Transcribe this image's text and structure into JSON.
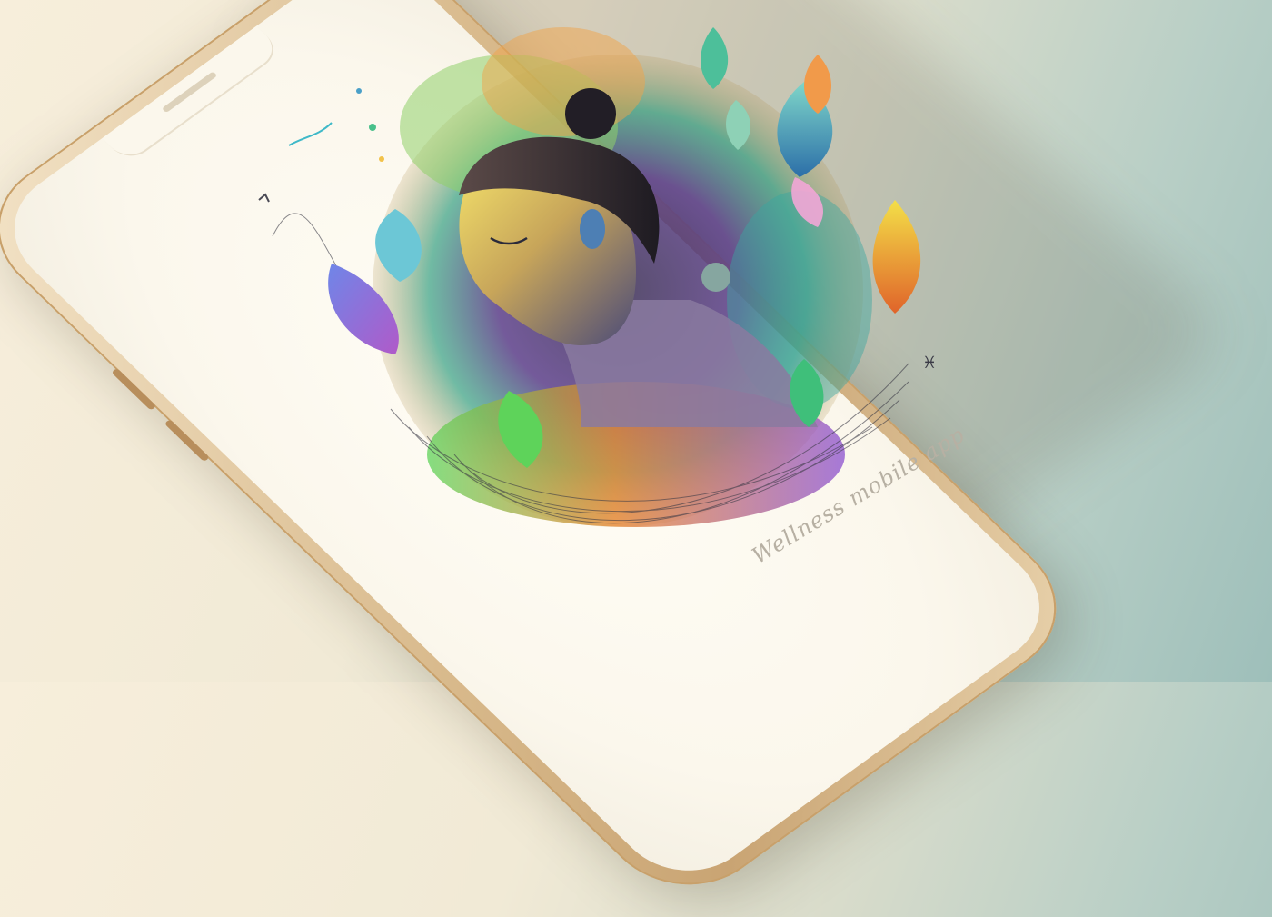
{
  "caption": "Wellness mobile app",
  "illustration": {
    "subject": "woman-portrait",
    "palette": [
      "#f7d84a",
      "#58c96b",
      "#36b9c9",
      "#8a5bd6",
      "#e86a2f",
      "#2a2a3a"
    ]
  },
  "colors": {
    "background_left": "#f7eedb",
    "background_right": "#9ebfba",
    "phone_frame": "#d8b98b",
    "screen": "#fbf7ec",
    "caption_text": "#b7b0a3"
  }
}
